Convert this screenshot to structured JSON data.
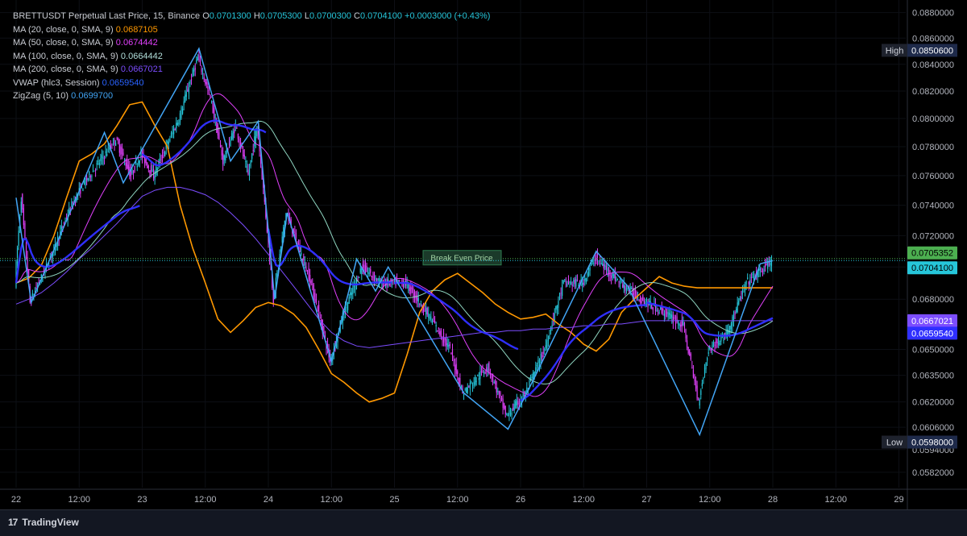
{
  "header": {
    "symbol": "BRETTUSDT Perpetual Last Price, 15, Binance",
    "open_key": "O",
    "open": "0.0701300",
    "high_key": "H",
    "high": "0.0705300",
    "low_key": "L",
    "low": "0.0700300",
    "close_key": "C",
    "close": "0.0704100",
    "change": "+0.0003000 (+0.43%)"
  },
  "legend": [
    {
      "label": "MA (20, close, 0, SMA, 9)",
      "value": "0.0687105",
      "color": "#ff9800"
    },
    {
      "label": "MA (50, close, 0, SMA, 9)",
      "value": "0.0674442",
      "color": "#e040fb"
    },
    {
      "label": "MA (100, close, 0, SMA, 9)",
      "value": "0.0664442",
      "color": "#b2dfdb"
    },
    {
      "label": "MA (200, close, 0, SMA, 9)",
      "value": "0.0667021",
      "color": "#7c4dff"
    },
    {
      "label": "VWAP (hlc3, Session)",
      "value": "0.0659540",
      "color": "#2962ff"
    },
    {
      "label": "ZigZag (5, 10)",
      "value": "0.0699700",
      "color": "#42a5f5"
    }
  ],
  "colors": {
    "up": "#26c6da",
    "down": "#e040fb",
    "ma20": "#ff9800",
    "ma50": "#e040fb",
    "ma100": "#8fd5c0",
    "ma200": "#7c4dff",
    "vwap": "#2f2fff",
    "zigzag": "#42a5f5"
  },
  "annotations": {
    "break_even_label": "Break Even Price",
    "break_even_value": "0.0705352",
    "last_price_value": "0.0704100",
    "ma200_tag": "0.0667021",
    "vwap_tag": "0.0659540",
    "high_label": "High",
    "high_value": "0.0850600",
    "low_label": "Low",
    "low_value": "0.0598000"
  },
  "footer": {
    "brand": "TradingView",
    "logo_text": "17"
  },
  "chart_data": {
    "type": "line",
    "title": "BRETTUSDT Perpetual Last Price, 15, Binance",
    "y_scale": "log",
    "y_ticks": [
      0.088,
      0.086,
      0.084,
      0.082,
      0.08,
      0.078,
      0.076,
      0.074,
      0.072,
      0.07,
      0.068,
      0.065,
      0.0635,
      0.062,
      0.0606,
      0.0594,
      0.0582
    ],
    "ylim": [
      0.0574,
      0.089
    ],
    "x_ticks": [
      "22",
      "12:00",
      "23",
      "12:00",
      "24",
      "12:00",
      "25",
      "12:00",
      "26",
      "12:00",
      "27",
      "12:00",
      "28",
      "12:00",
      "29"
    ],
    "x": [
      0,
      0.1,
      0.2,
      0.3,
      0.4,
      0.5,
      0.6,
      0.7,
      0.8,
      0.9,
      1.0,
      1.1,
      1.2,
      1.3,
      1.4,
      1.5,
      1.6,
      1.7,
      1.8,
      1.9,
      2.0,
      2.1,
      2.2,
      2.3,
      2.4,
      2.5,
      2.6,
      2.7,
      2.8,
      2.9,
      3.0,
      3.1,
      3.2,
      3.3,
      3.4,
      3.5,
      3.6,
      3.7,
      3.8,
      3.9,
      4.0,
      4.1,
      4.2,
      4.3,
      4.4,
      4.5,
      4.6,
      4.7,
      4.8,
      4.9,
      5.0,
      5.1,
      5.2,
      5.3,
      5.4,
      5.5,
      5.6,
      5.7,
      5.8,
      5.9,
      6.0
    ],
    "series": [
      {
        "name": "MA (20, close, 0, SMA, 9)",
        "values": [
          0.069,
          0.0693,
          0.0701,
          0.072,
          0.0745,
          0.077,
          0.0775,
          0.0782,
          0.0795,
          0.081,
          0.0812,
          0.0795,
          0.078,
          0.074,
          0.0712,
          0.069,
          0.0668,
          0.066,
          0.0667,
          0.0675,
          0.0678,
          0.0676,
          0.0671,
          0.0663,
          0.065,
          0.0636,
          0.0631,
          0.0625,
          0.062,
          0.0622,
          0.0625,
          0.0647,
          0.0672,
          0.0685,
          0.0692,
          0.0696,
          0.069,
          0.0684,
          0.0677,
          0.0672,
          0.0668,
          0.0669,
          0.0671,
          0.0665,
          0.066,
          0.0653,
          0.0649,
          0.0656,
          0.0672,
          0.068,
          0.0687,
          0.0694,
          0.069,
          0.0688,
          0.0687,
          0.0687,
          0.0687,
          0.0687,
          0.0687,
          0.0687,
          0.0687
        ]
      },
      {
        "name": "MA (200, close, 0, SMA, 9)",
        "values": [
          0.0677,
          0.068,
          0.0684,
          0.069,
          0.0697,
          0.0705,
          0.0712,
          0.072,
          0.0728,
          0.0737,
          0.0746,
          0.075,
          0.0752,
          0.0752,
          0.075,
          0.0747,
          0.0742,
          0.0735,
          0.0727,
          0.0718,
          0.0708,
          0.0698,
          0.0688,
          0.0678,
          0.0668,
          0.066,
          0.0655,
          0.0652,
          0.0651,
          0.0652,
          0.0653,
          0.0654,
          0.0655,
          0.0656,
          0.0657,
          0.0658,
          0.0659,
          0.066,
          0.066,
          0.0661,
          0.0661,
          0.0662,
          0.0662,
          0.0663,
          0.0663,
          0.0664,
          0.0664,
          0.0665,
          0.0665,
          0.0666,
          0.0667,
          0.0667,
          0.0667,
          0.0667,
          0.0667,
          0.0667,
          0.0667,
          0.0667,
          0.0667,
          0.0667,
          0.0667
        ]
      }
    ]
  }
}
